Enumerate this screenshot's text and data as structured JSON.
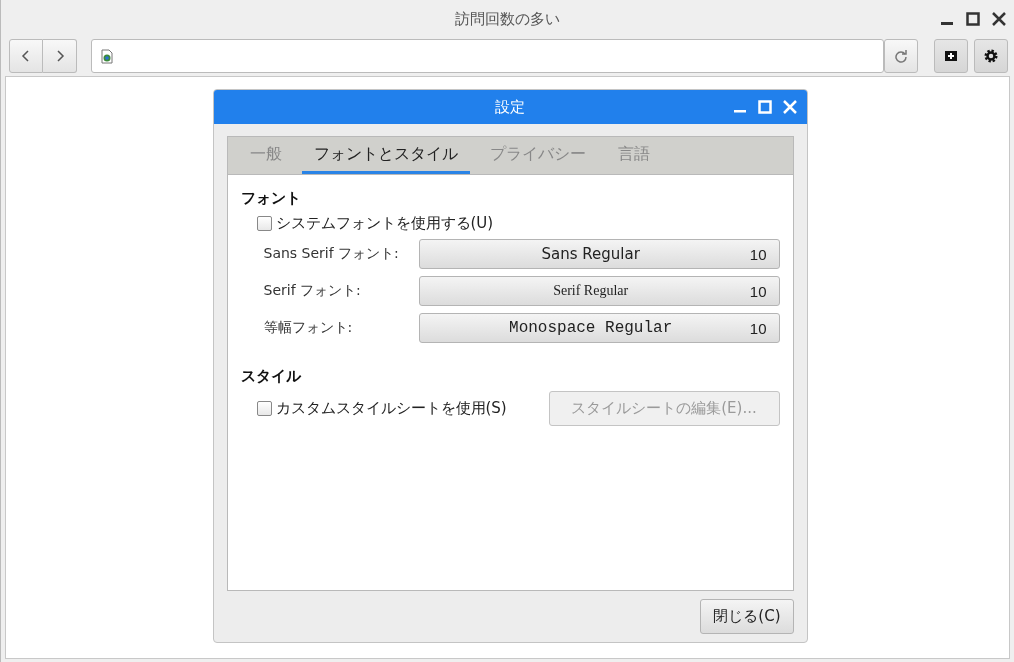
{
  "window": {
    "title": "訪問回数の多い"
  },
  "dialog": {
    "title": "設定",
    "tabs": [
      {
        "label": "一般",
        "selected": false
      },
      {
        "label": "フォントとスタイル",
        "selected": true
      },
      {
        "label": "プライバシー",
        "selected": false
      },
      {
        "label": "言語",
        "selected": false
      }
    ],
    "font_section": {
      "heading": "フォント",
      "system_font": {
        "label": "システムフォントを使用する(U)",
        "checked": false
      },
      "fonts": [
        {
          "label": "Sans Serif フォント:",
          "kind": "sans",
          "name": "Sans Regular",
          "size": "10"
        },
        {
          "label": "Serif フォント:",
          "kind": "serif",
          "name": "Serif Regular",
          "size": "10"
        },
        {
          "label": "等幅フォント:",
          "kind": "mono",
          "name": "Monospace Regular",
          "size": "10"
        }
      ]
    },
    "style_section": {
      "heading": "スタイル",
      "custom_stylesheet": {
        "label": "カスタムスタイルシートを使用(S)",
        "checked": false
      },
      "edit_button": {
        "label": "スタイルシートの編集(E)...",
        "disabled": true
      }
    },
    "close_button": "閉じる(C)"
  }
}
